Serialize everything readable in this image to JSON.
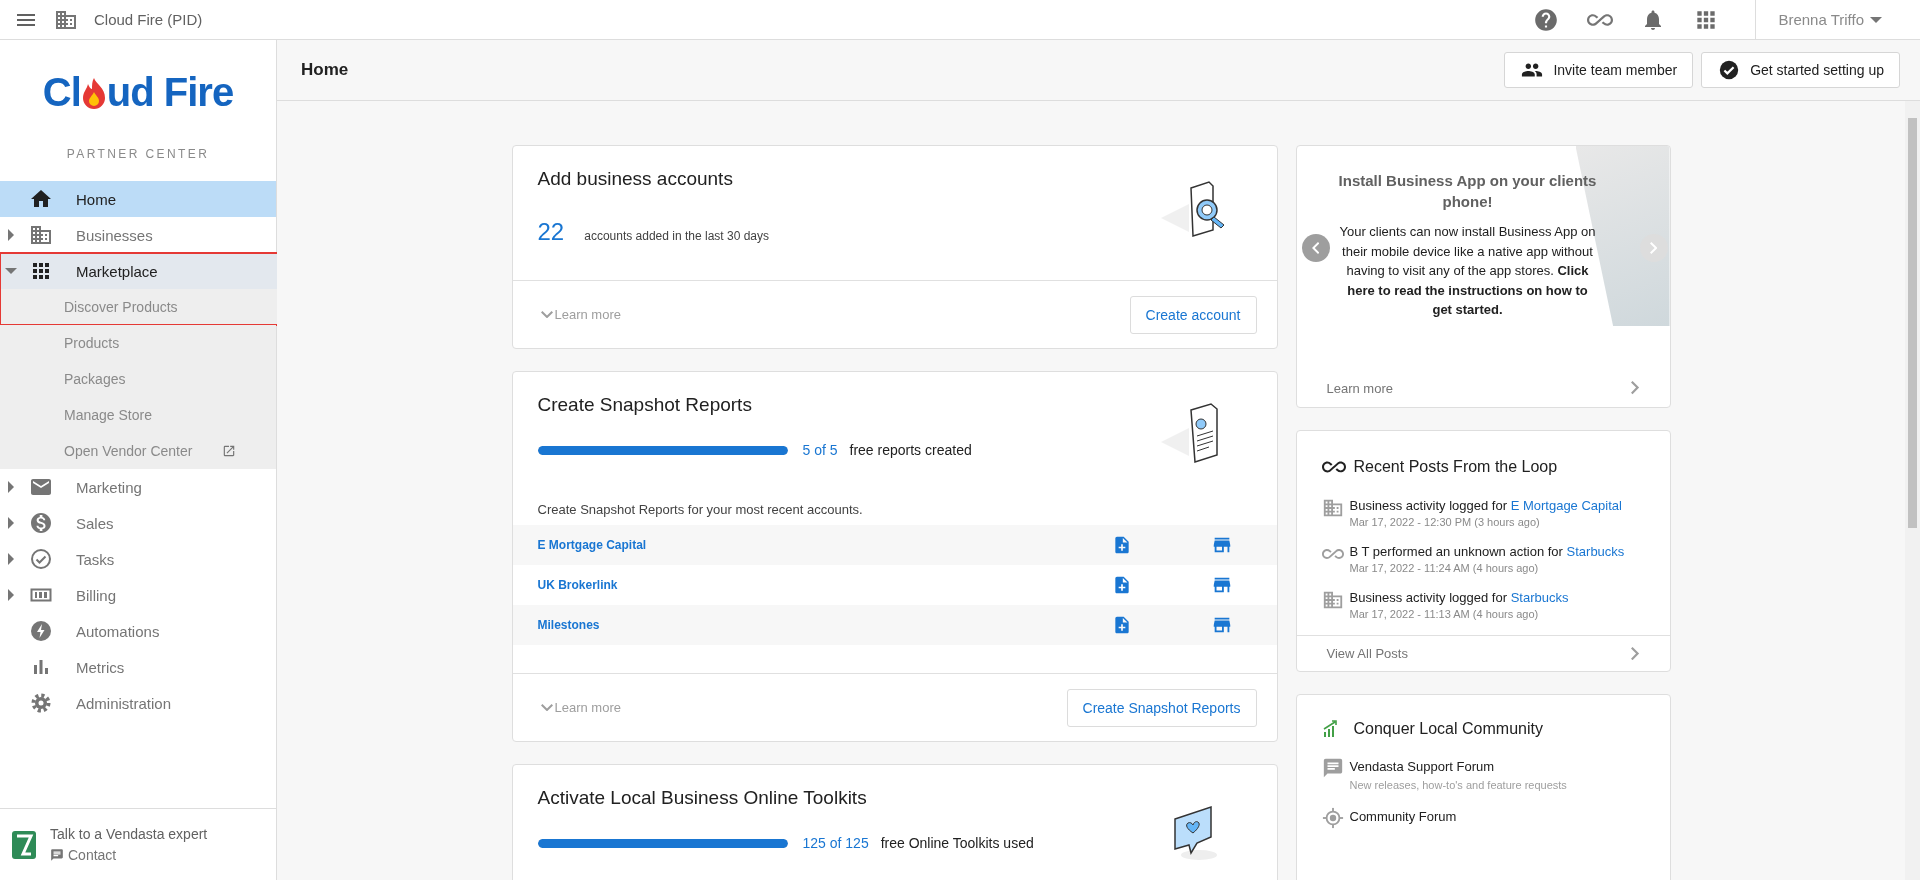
{
  "topbar": {
    "brand": "Cloud Fire (PID)",
    "user": "Brenna Triffo"
  },
  "sidebar": {
    "logo": {
      "before": "Cl",
      "after": "ud Fire"
    },
    "subtitle": "PARTNER CENTER",
    "items": [
      {
        "label": "Home",
        "selected": true,
        "highlighted": false
      },
      {
        "label": "Businesses",
        "selected": false,
        "expanded": false,
        "highlighted": false
      },
      {
        "label": "Marketplace",
        "selected": false,
        "expanded": true,
        "highlighted": true,
        "children": [
          {
            "label": "Discover Products",
            "selected": false,
            "external": false,
            "highlighted": true
          },
          {
            "label": "Products",
            "selected": false,
            "external": false,
            "highlighted": false
          },
          {
            "label": "Packages",
            "selected": false,
            "external": false,
            "highlighted": false
          },
          {
            "label": "Manage Store",
            "selected": false,
            "external": false,
            "highlighted": false
          },
          {
            "label": "Open Vendor Center",
            "selected": false,
            "external": true,
            "highlighted": false
          }
        ]
      },
      {
        "label": "Marketing",
        "selected": false,
        "expanded": false,
        "highlighted": false
      },
      {
        "label": "Sales",
        "selected": false,
        "expanded": false,
        "highlighted": false
      },
      {
        "label": "Tasks",
        "selected": false,
        "expanded": false,
        "highlighted": false
      },
      {
        "label": "Billing",
        "selected": false,
        "expanded": false,
        "highlighted": false
      },
      {
        "label": "Automations",
        "selected": false,
        "highlighted": false
      },
      {
        "label": "Metrics",
        "selected": false,
        "highlighted": false
      },
      {
        "label": "Administration",
        "selected": false,
        "highlighted": false
      }
    ],
    "footer": {
      "title": "Talk to a Vendasta expert",
      "link": "Contact"
    }
  },
  "header": {
    "title": "Home",
    "buttons": [
      {
        "label": "Invite team member"
      },
      {
        "label": "Get started setting up"
      }
    ]
  },
  "accounts_card": {
    "title": "Add business accounts",
    "count": "22",
    "caption": "accounts added in the last 30 days",
    "learn_more": "Learn more",
    "button": "Create account"
  },
  "snapshot_card": {
    "title": "Create Snapshot Reports",
    "level": 1,
    "reading": "5 of 5",
    "caption": "free reports created",
    "description": "Create Snapshot Reports for your most recent accounts.",
    "rows": [
      {
        "name": "E Mortgage Capital"
      },
      {
        "name": "UK Brokerlink"
      },
      {
        "name": "Milestones"
      }
    ],
    "learn_more": "Learn more",
    "button": "Create Snapshot Reports"
  },
  "toolkits_card": {
    "title": "Activate Local Business Online Toolkits",
    "level": 1,
    "reading": "125 of 125",
    "caption": "free Online Toolkits used"
  },
  "promo_card": {
    "title": "Install Business App on your clients phone!",
    "body": "Your clients can now install Business App on their mobile device like a native app without having to visit any of the app stores. **Click here to read the instructions on how to get started.**",
    "link": "Learn more"
  },
  "loop_card": {
    "title": "Recent Posts From the Loop",
    "posts": [
      {
        "kind": "business",
        "text": "Business activity logged for",
        "link": "E Mortgage Capital",
        "time": "Mar 17, 2022 - 12:30 PM (3 hours ago)"
      },
      {
        "kind": "loop",
        "text": "B T performed an unknown action for",
        "link": "Starbucks",
        "time": "Mar 17, 2022 - 11:24 AM (4 hours ago)"
      },
      {
        "kind": "business",
        "text": "Business activity logged for",
        "link": "Starbucks",
        "time": "Mar 17, 2022 - 11:13 AM (4 hours ago)"
      }
    ],
    "footer": "View All Posts"
  },
  "community_card": {
    "title": "Conquer Local Community",
    "items": [
      {
        "kind": "chat",
        "title": "Vendasta Support Forum",
        "subtitle": "New releases, how-to's and feature requests"
      },
      {
        "kind": "target",
        "title": "Community Forum"
      }
    ]
  }
}
